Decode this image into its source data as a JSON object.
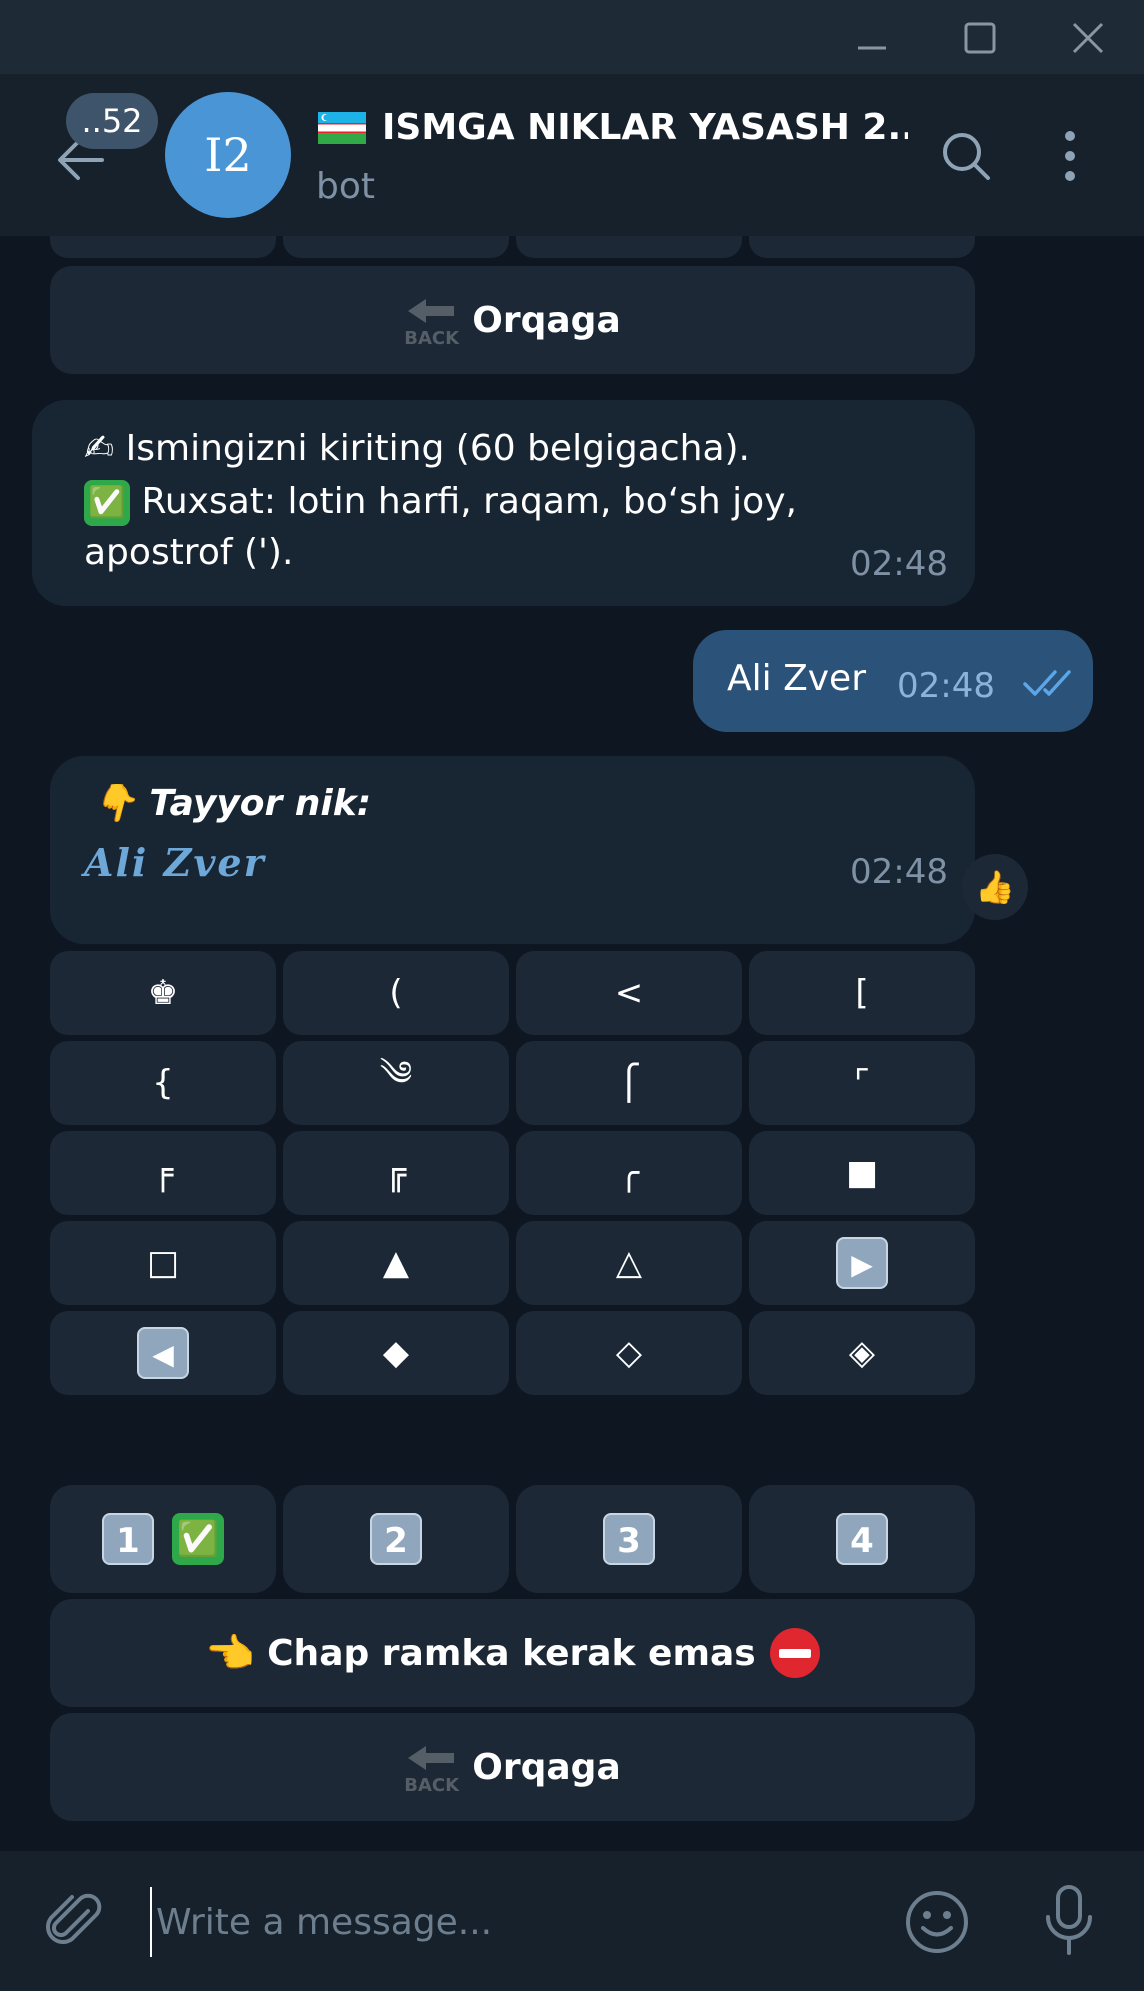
{
  "header": {
    "unread_count": "..52",
    "avatar_initials": "I2",
    "title": "ISMGA NIKLAR YASASH 2...",
    "subtitle": "bot"
  },
  "messages": {
    "top_back_button": {
      "icon": "BACK",
      "label": "Orqaga"
    },
    "prompt": {
      "line1_emoji": "✍",
      "line1": "Ismingizni kiriting (60 belgigacha).",
      "line2_emoji": "✅",
      "line2": "Ruxsat: lotin harfi, raqam, bo‘sh joy,",
      "line3": "apostrof (').",
      "time": "02:48"
    },
    "outgoing": {
      "text": "Ali Zver",
      "time": "02:48"
    },
    "result": {
      "emoji": "👇",
      "label": "Tayyor nik:",
      "nik": "Ali  Zver",
      "time": "02:48",
      "reaction": "👍"
    },
    "symbols": [
      [
        "♚",
        "(",
        "<",
        "["
      ],
      [
        "{",
        "༄",
        "⎧",
        "⌜"
      ],
      [
        "╒",
        "╔",
        "╭",
        "■"
      ],
      [
        "□",
        "▲",
        "△",
        "▶"
      ],
      [
        "◀",
        "◆",
        "◇",
        "◈"
      ]
    ],
    "numbers": [
      {
        "label": "1",
        "check": "✅"
      },
      {
        "label": "2"
      },
      {
        "label": "3"
      },
      {
        "label": "4"
      }
    ],
    "no_frame_button": {
      "emoji_left": "👈",
      "label": "Chap ramka kerak emas",
      "emoji_right": "⛔"
    },
    "bottom_back_button": {
      "icon": "BACK",
      "label": "Orqaga"
    }
  },
  "composer": {
    "placeholder": "Write a message..."
  },
  "colors": {
    "background": "#0e1621",
    "header": "#17212b",
    "bubble_in": "#182533",
    "bubble_out": "#2b5278",
    "keyboard_button": "#1c2836",
    "avatar": "#4a95d6",
    "muted_text": "#7f91a4",
    "check_marks": "#5aa6e8"
  }
}
